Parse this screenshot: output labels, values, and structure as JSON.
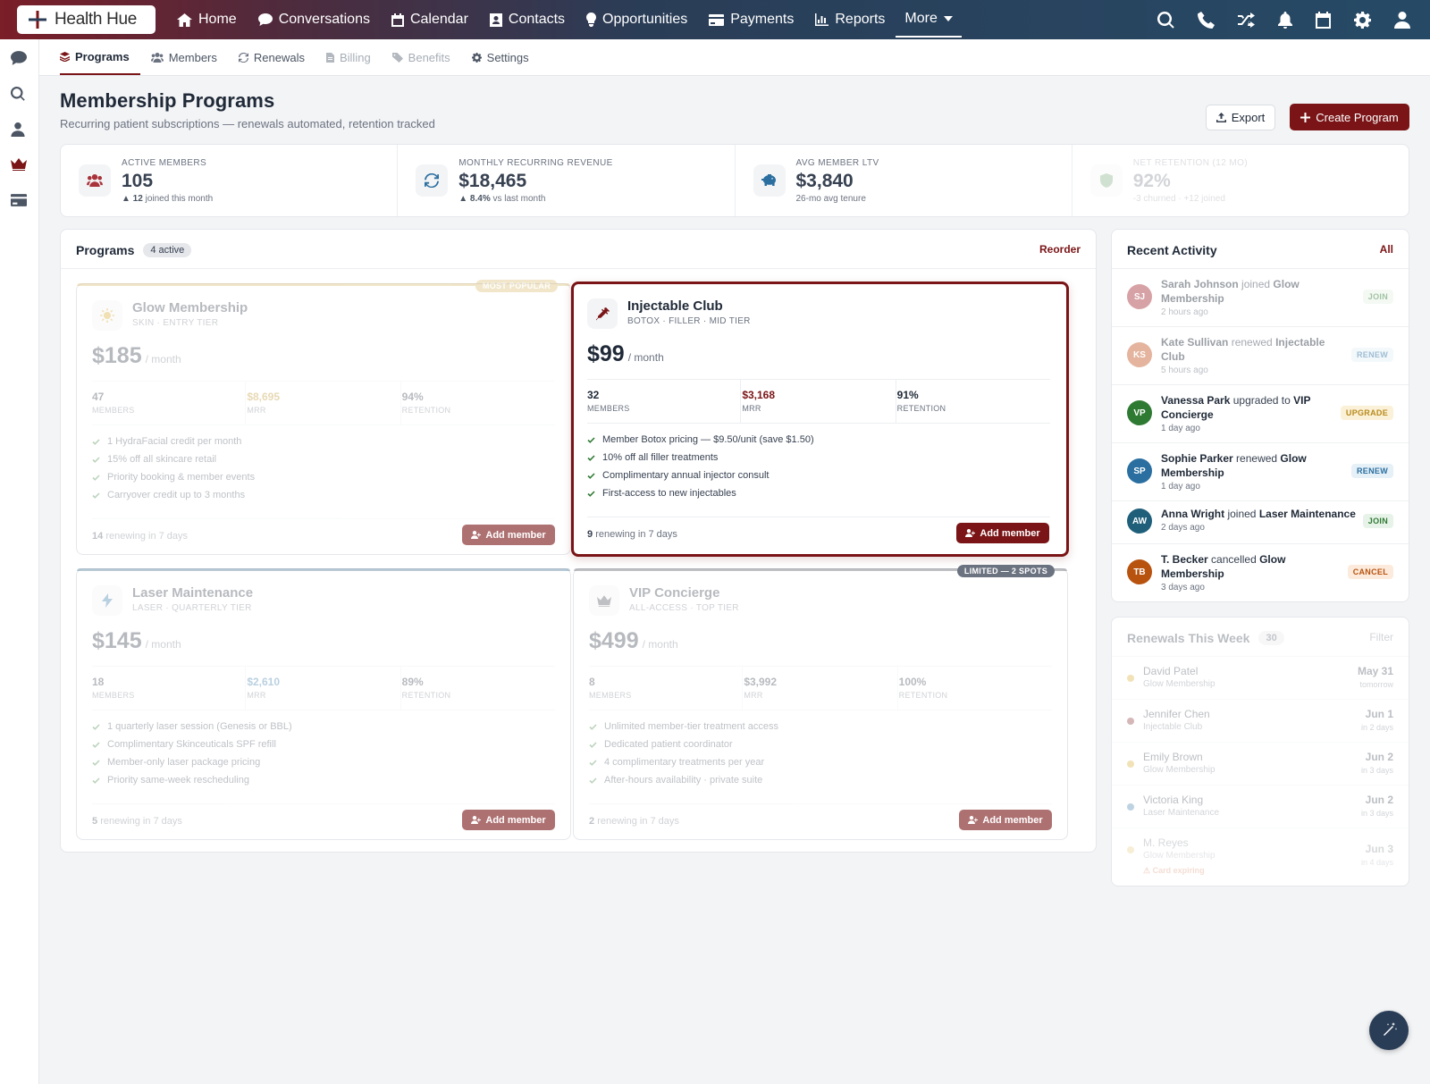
{
  "app": {
    "name": "Health Hue"
  },
  "nav": {
    "home": "Home",
    "conversations": "Conversations",
    "calendar": "Calendar",
    "contacts": "Contacts",
    "opportunities": "Opportunities",
    "payments": "Payments",
    "reports": "Reports",
    "more": "More"
  },
  "tabs": {
    "programs": "Programs",
    "members": "Members",
    "renewals": "Renewals",
    "billing": "Billing",
    "benefits": "Benefits",
    "settings": "Settings"
  },
  "header": {
    "title": "Membership Programs",
    "subtitle": "Recurring patient subscriptions — renewals automated, retention tracked",
    "export_label": "Export",
    "create_label": "Create Program"
  },
  "stats": [
    {
      "label": "ACTIVE MEMBERS",
      "value": "105",
      "sub_strong": "▲ 12",
      "sub": "joined this month"
    },
    {
      "label": "MONTHLY RECURRING REVENUE",
      "value": "$18,465",
      "sub_strong": "▲ 8.4%",
      "sub": "vs last month"
    },
    {
      "label": "AVG MEMBER LTV",
      "value": "$3,840",
      "sub_strong": "",
      "sub": "26-mo avg tenure"
    },
    {
      "label": "NET RETENTION (12 MO)",
      "value": "92%",
      "sub_strong": "",
      "sub": "-3 churned · +12 joined"
    }
  ],
  "programs_panel": {
    "title": "Programs",
    "count_label": "4 active",
    "reorder_label": "Reorder"
  },
  "programs": [
    {
      "name": "Glow Membership",
      "subtitle": "SKIN · ENTRY TIER",
      "price": "$185",
      "period": "/ month",
      "members": "47",
      "mrr": "$8,695",
      "retention": "94%",
      "ribbon": "MOST POPULAR",
      "features": [
        "1 HydraFacial credit per month",
        "15% off all skincare retail",
        "Priority booking & member events",
        "Carryover credit up to 3 months"
      ],
      "renewing_count": "14",
      "renewing_text": "renewing in 7 days",
      "add_label": "Add member",
      "accent": "#d4b25a"
    },
    {
      "name": "Injectable Club",
      "subtitle": "BOTOX · FILLER · MID TIER",
      "price": "$99",
      "period": "/ month",
      "members": "32",
      "mrr": "$3,168",
      "retention": "91%",
      "features": [
        "Member Botox pricing — $9.50/unit (save $1.50)",
        "10% off all filler treatments",
        "Complimentary annual injector consult",
        "First-access to new injectables"
      ],
      "renewing_count": "9",
      "renewing_text": "renewing in 7 days",
      "add_label": "Add member",
      "accent": "#7a1416"
    },
    {
      "name": "Laser Maintenance",
      "subtitle": "LASER · QUARTERLY TIER",
      "price": "$145",
      "period": "/ month",
      "members": "18",
      "mrr": "$2,610",
      "retention": "89%",
      "features": [
        "1 quarterly laser session (Genesis or BBL)",
        "Complimentary Skinceuticals SPF refill",
        "Member-only laser package pricing",
        "Priority same-week rescheduling"
      ],
      "renewing_count": "5",
      "renewing_text": "renewing in 7 days",
      "add_label": "Add member",
      "accent": "#2a5f82"
    },
    {
      "name": "VIP Concierge",
      "subtitle": "ALL-ACCESS · TOP TIER",
      "price": "$499",
      "period": "/ month",
      "members": "8",
      "mrr": "$3,992",
      "retention": "100%",
      "ribbon": "LIMITED — 2 SPOTS",
      "features": [
        "Unlimited member-tier treatment access",
        "Dedicated patient coordinator",
        "4 complimentary treatments per year",
        "After-hours availability · private suite"
      ],
      "renewing_count": "2",
      "renewing_text": "renewing in 7 days",
      "add_label": "Add member",
      "accent": "#3b3f46"
    }
  ],
  "metric_labels": {
    "members": "MEMBERS",
    "mrr": "MRR",
    "retention": "RETENTION"
  },
  "activity": {
    "title": "Recent Activity",
    "all_label": "All",
    "items": [
      {
        "initials": "SJ",
        "name": "Sarah Johnson",
        "action": "joined",
        "target": "Glow Membership",
        "time": "2 hours ago",
        "badge": "JOIN",
        "color": "#a8333a"
      },
      {
        "initials": "KS",
        "name": "Kate Sullivan",
        "action": "renewed",
        "target": "Injectable Club",
        "time": "5 hours ago",
        "badge": "RENEW",
        "color": "#c45a2a"
      },
      {
        "initials": "VP",
        "name": "Vanessa Park",
        "action": "upgraded to",
        "target": "VIP Concierge",
        "time": "1 day ago",
        "badge": "UPGRADE",
        "color": "#2f7a33"
      },
      {
        "initials": "SP",
        "name": "Sophie Parker",
        "action": "renewed",
        "target": "Glow Membership",
        "time": "1 day ago",
        "badge": "RENEW",
        "color": "#2a6fa0"
      },
      {
        "initials": "AW",
        "name": "Anna Wright",
        "action": "joined",
        "target": "Laser Maintenance",
        "time": "2 days ago",
        "badge": "JOIN",
        "color": "#1f5f7a"
      },
      {
        "initials": "TB",
        "name": "T. Becker",
        "action": "cancelled",
        "target": "Glow Membership",
        "time": "3 days ago",
        "badge": "CANCEL",
        "color": "#b8520f"
      }
    ]
  },
  "renewals": {
    "title": "Renewals This Week",
    "count": "30",
    "filter_label": "Filter",
    "items": [
      {
        "name": "David Patel",
        "program": "Glow Membership",
        "date": "May 31",
        "rel": "tomorrow",
        "dot": "#d4a017"
      },
      {
        "name": "Jennifer Chen",
        "program": "Injectable Club",
        "date": "Jun 1",
        "rel": "in 2 days",
        "dot": "#7a1416"
      },
      {
        "name": "Emily Brown",
        "program": "Glow Membership",
        "date": "Jun 2",
        "rel": "in 3 days",
        "dot": "#d4a017"
      },
      {
        "name": "Victoria King",
        "program": "Laser Maintenance",
        "date": "Jun 2",
        "rel": "in 3 days",
        "dot": "#2a6fa0"
      },
      {
        "name": "M. Reyes",
        "program": "Glow Membership",
        "date": "Jun 3",
        "rel": "in 4 days",
        "dot": "#d4a017",
        "warn": "⚠ Card expiring"
      }
    ]
  }
}
